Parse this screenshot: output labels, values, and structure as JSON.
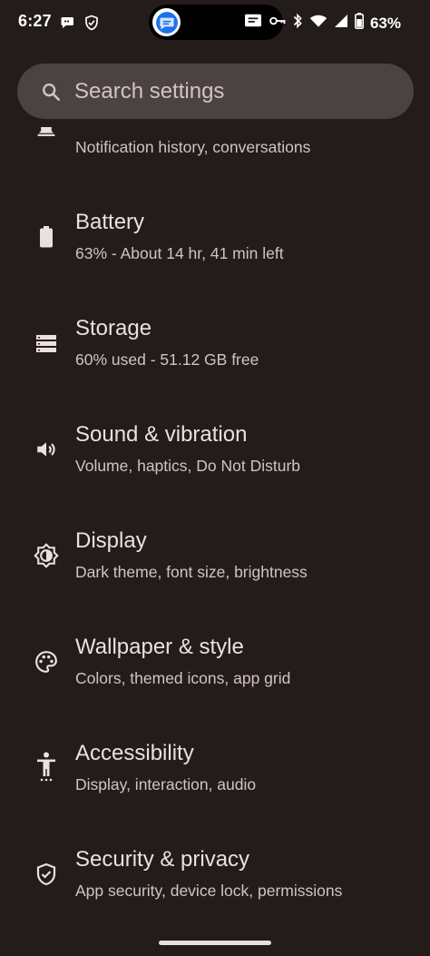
{
  "status_bar": {
    "time": "6:27",
    "battery_percent": "63%",
    "left_icons": [
      "chat-bubble-icon",
      "shield-check-icon"
    ],
    "pill_app_icon": "messages-app-icon",
    "right_icons": [
      "cast-icon",
      "vpn-key-icon",
      "bluetooth-icon",
      "wifi-icon",
      "cellular-signal-icon",
      "battery-icon"
    ]
  },
  "search": {
    "placeholder": "Search settings"
  },
  "partial_item": {
    "subtitle": "Notification history, conversations",
    "icon": "notifications-icon"
  },
  "items": [
    {
      "title": "Battery",
      "subtitle": "63% - About 14 hr, 41 min left",
      "icon": "battery-icon"
    },
    {
      "title": "Storage",
      "subtitle": "60% used - 51.12 GB free",
      "icon": "storage-icon"
    },
    {
      "title": "Sound & vibration",
      "subtitle": "Volume, haptics, Do Not Disturb",
      "icon": "volume-icon"
    },
    {
      "title": "Display",
      "subtitle": "Dark theme, font size, brightness",
      "icon": "brightness-icon"
    },
    {
      "title": "Wallpaper & style",
      "subtitle": "Colors, themed icons, app grid",
      "icon": "palette-icon"
    },
    {
      "title": "Accessibility",
      "subtitle": "Display, interaction, audio",
      "icon": "accessibility-icon"
    },
    {
      "title": "Security & privacy",
      "subtitle": "App security, device lock, permissions",
      "icon": "security-shield-icon"
    }
  ],
  "colors": {
    "background": "#231c1b",
    "search_bg": "#4b4341",
    "title_text": "#ece0dd",
    "subtitle_text": "#d3c3c0"
  }
}
